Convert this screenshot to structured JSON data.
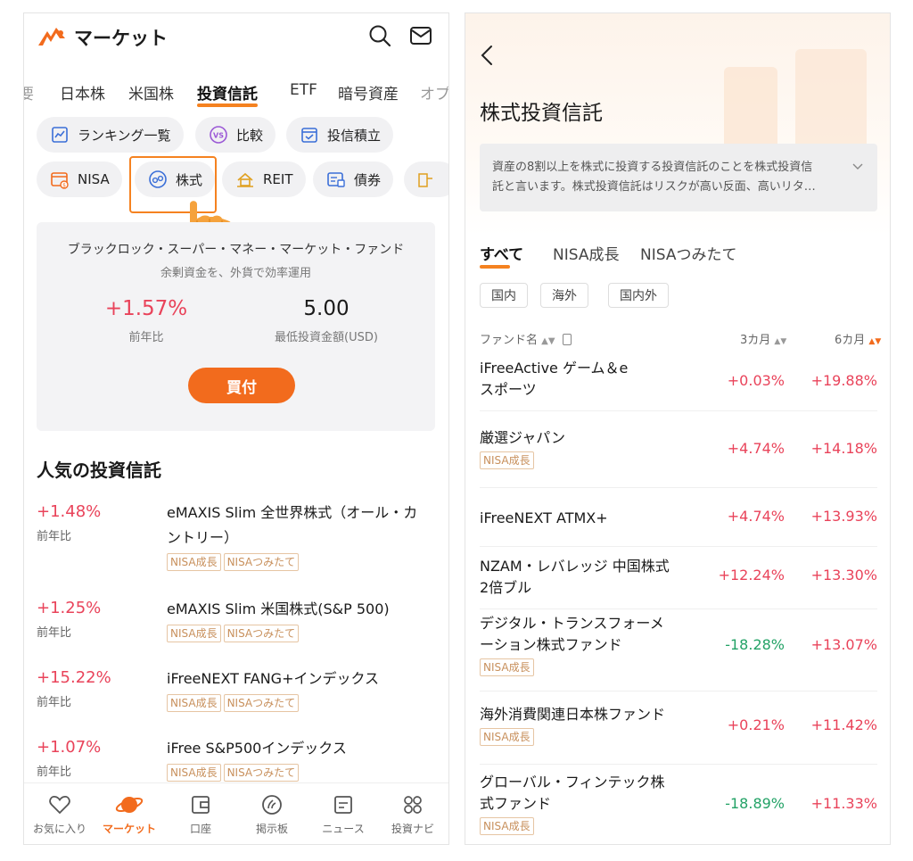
{
  "left": {
    "header": {
      "title": "マーケット"
    },
    "tabs": [
      "要",
      "日本株",
      "米国株",
      "投資信託",
      "ETF",
      "暗号資産",
      "オプ"
    ],
    "chips_row1": [
      {
        "label": "ランキング一覧",
        "icon": "ranking-chart-icon"
      },
      {
        "label": "比較",
        "icon": "vs-icon"
      },
      {
        "label": "投信積立",
        "icon": "calendar-check-icon"
      }
    ],
    "chips_row2": [
      {
        "label": "NISA",
        "icon": "nisa-wallet-icon"
      },
      {
        "label": "株式",
        "icon": "stock-icon"
      },
      {
        "label": "REIT",
        "icon": "reit-building-icon"
      },
      {
        "label": "債券",
        "icon": "bond-icon"
      }
    ],
    "promo": {
      "fund_name": "ブラックロック・スーパー・マネー・マーケット・ファンド",
      "subtitle": "余剰資金を、外貨で効率運用",
      "return_value": "+1.57%",
      "return_label": "前年比",
      "min_amount": "5.00",
      "min_amount_label": "最低投資金額(USD)",
      "buy_label": "買付"
    },
    "popular": {
      "title": "人気の投資信託",
      "items": [
        {
          "pct": "+1.48%",
          "sub": "前年比",
          "name_line1": "eMAXIS Slim 全世界株式（オール・カ",
          "name_line2": "ントリー）",
          "tags": [
            "NISA成長",
            "NISAつみたて"
          ]
        },
        {
          "pct": "+1.25%",
          "sub": "前年比",
          "name_line1": "eMAXIS Slim 米国株式(S&P 500)",
          "name_line2": "",
          "tags": [
            "NISA成長",
            "NISAつみたて"
          ]
        },
        {
          "pct": "+15.22%",
          "sub": "前年比",
          "name_line1": "iFreeNEXT FANG+インデックス",
          "name_line2": "",
          "tags": [
            "NISA成長",
            "NISAつみたて"
          ]
        },
        {
          "pct": "+1.07%",
          "sub": "前年比",
          "name_line1": "iFree S&P500インデックス",
          "name_line2": "",
          "tags": [
            "NISA成長",
            "NISAつみたて"
          ]
        }
      ]
    },
    "nav": [
      {
        "label": "お気に入り",
        "icon": "heart-icon"
      },
      {
        "label": "マーケット",
        "icon": "planet-icon"
      },
      {
        "label": "口座",
        "icon": "wallet-icon"
      },
      {
        "label": "掲示板",
        "icon": "board-icon"
      },
      {
        "label": "ニュース",
        "icon": "news-icon"
      },
      {
        "label": "投資ナビ",
        "icon": "grid-icon"
      }
    ]
  },
  "right": {
    "title": "株式投資信託",
    "description_line1": "資産の8割以上を株式に投資する投資信託のことを株式投資信",
    "description_line2": "託と言います。株式投資信託はリスクが高い反面、高いリタ…",
    "tabs": [
      "すべて",
      "NISA成長",
      "NISAつみたて"
    ],
    "filters": [
      "国内",
      "海外",
      "国内外"
    ],
    "columns": {
      "name": "ファンド名",
      "m3": "3カ月",
      "m6": "6カ月"
    },
    "funds": [
      {
        "name_line1": "iFreeActive ゲーム＆e",
        "name_line2": "スポーツ",
        "tag": "",
        "m3": "+0.03%",
        "m6": "+19.88%"
      },
      {
        "name_line1": "厳選ジャパン",
        "name_line2": "",
        "tag": "NISA成長",
        "m3": "+4.74%",
        "m6": "+14.18%"
      },
      {
        "name_line1": "iFreeNEXT ATMX+",
        "name_line2": "",
        "tag": "",
        "m3": "+4.74%",
        "m6": "+13.93%"
      },
      {
        "name_line1": "NZAM・レバレッジ 中国株式",
        "name_line2": "2倍ブル",
        "tag": "",
        "m3": "+12.24%",
        "m6": "+13.30%"
      },
      {
        "name_line1": "デジタル・トランスフォーメ",
        "name_line2": "ーション株式ファンド",
        "tag": "NISA成長",
        "m3": "-18.28%",
        "m6": "+13.07%"
      },
      {
        "name_line1": "海外消費関連日本株ファンド",
        "name_line2": "",
        "tag": "NISA成長",
        "m3": "+0.21%",
        "m6": "+11.42%"
      },
      {
        "name_line1": "グローバル・フィンテック株",
        "name_line2": "式ファンド",
        "tag": "NISA成長",
        "m3": "-18.89%",
        "m6": "+11.33%"
      }
    ]
  },
  "colors": {
    "accent": "#f26b1d",
    "up": "#e9435a",
    "down": "#23a266",
    "tag_border": "#e6c5a3"
  }
}
